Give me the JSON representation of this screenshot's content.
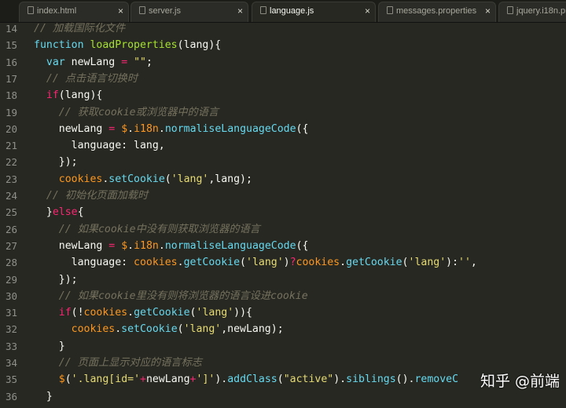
{
  "tabs": [
    {
      "label": "index.html",
      "active": false
    },
    {
      "label": "server.js",
      "active": false
    },
    {
      "label": "language.js",
      "active": true
    },
    {
      "label": "messages.properties",
      "active": false
    },
    {
      "label": "jquery.i18n.pr",
      "active": false
    }
  ],
  "close_glyph": "×",
  "lines": [
    {
      "n": "14",
      "t": [
        [
          "cm",
          "// 加载国际化文件"
        ]
      ]
    },
    {
      "n": "15",
      "t": [
        [
          "kw",
          "function "
        ],
        [
          "fn",
          "loadProperties"
        ],
        [
          "pl",
          "(lang){"
        ]
      ]
    },
    {
      "n": "16",
      "t": [
        [
          "pl",
          "  "
        ],
        [
          "kw",
          "var "
        ],
        [
          "pl",
          "newLang "
        ],
        [
          "kw2",
          "="
        ],
        [
          "pl",
          " "
        ],
        [
          "str",
          "\"\""
        ],
        [
          "pl",
          ";"
        ]
      ]
    },
    {
      "n": "17",
      "t": [
        [
          "pl",
          "  "
        ],
        [
          "cm",
          "// 点击语言切换时"
        ]
      ]
    },
    {
      "n": "18",
      "t": [
        [
          "pl",
          "  "
        ],
        [
          "kw2",
          "if"
        ],
        [
          "pl",
          "(lang){"
        ]
      ]
    },
    {
      "n": "19",
      "t": [
        [
          "pl",
          "    "
        ],
        [
          "cm",
          "// 获取cookie或浏览器中的语言"
        ]
      ]
    },
    {
      "n": "20",
      "t": [
        [
          "pl",
          "    newLang "
        ],
        [
          "kw2",
          "="
        ],
        [
          "pl",
          " "
        ],
        [
          "obj",
          "$"
        ],
        [
          "pl",
          "."
        ],
        [
          "obj",
          "i18n"
        ],
        [
          "pl",
          "."
        ],
        [
          "kw",
          "normaliseLanguageCode"
        ],
        [
          "pl",
          "({"
        ]
      ]
    },
    {
      "n": "21",
      "t": [
        [
          "pl",
          "      language: lang,"
        ]
      ]
    },
    {
      "n": "22",
      "t": [
        [
          "pl",
          "    });"
        ]
      ]
    },
    {
      "n": "23",
      "t": [
        [
          "pl",
          "    "
        ],
        [
          "obj",
          "cookies"
        ],
        [
          "pl",
          "."
        ],
        [
          "kw",
          "setCookie"
        ],
        [
          "pl",
          "("
        ],
        [
          "str",
          "'lang'"
        ],
        [
          "pl",
          ",lang);"
        ]
      ]
    },
    {
      "n": "24",
      "t": [
        [
          "pl",
          "  "
        ],
        [
          "cm",
          "// 初始化页面加载时"
        ]
      ]
    },
    {
      "n": "25",
      "t": [
        [
          "pl",
          "  }"
        ],
        [
          "kw2",
          "else"
        ],
        [
          "pl",
          "{"
        ]
      ]
    },
    {
      "n": "26",
      "t": [
        [
          "pl",
          "    "
        ],
        [
          "cm",
          "// 如果cookie中没有则获取浏览器的语言"
        ]
      ]
    },
    {
      "n": "27",
      "t": [
        [
          "pl",
          "    newLang "
        ],
        [
          "kw2",
          "="
        ],
        [
          "pl",
          " "
        ],
        [
          "obj",
          "$"
        ],
        [
          "pl",
          "."
        ],
        [
          "obj",
          "i18n"
        ],
        [
          "pl",
          "."
        ],
        [
          "kw",
          "normaliseLanguageCode"
        ],
        [
          "pl",
          "({"
        ]
      ]
    },
    {
      "n": "28",
      "t": [
        [
          "pl",
          "      language: "
        ],
        [
          "obj",
          "cookies"
        ],
        [
          "pl",
          "."
        ],
        [
          "kw",
          "getCookie"
        ],
        [
          "pl",
          "("
        ],
        [
          "str",
          "'lang'"
        ],
        [
          "pl",
          ")"
        ],
        [
          "kw2",
          "?"
        ],
        [
          "obj",
          "cookies"
        ],
        [
          "pl",
          "."
        ],
        [
          "kw",
          "getCookie"
        ],
        [
          "pl",
          "("
        ],
        [
          "str",
          "'lang'"
        ],
        [
          "pl",
          "):"
        ],
        [
          "str",
          "''"
        ],
        [
          "pl",
          ","
        ]
      ]
    },
    {
      "n": "29",
      "t": [
        [
          "pl",
          "    });"
        ]
      ]
    },
    {
      "n": "30",
      "t": [
        [
          "pl",
          "    "
        ],
        [
          "cm",
          "// 如果cookie里没有则将浏览器的语言设进cookie"
        ]
      ]
    },
    {
      "n": "31",
      "t": [
        [
          "pl",
          "    "
        ],
        [
          "kw2",
          "if"
        ],
        [
          "pl",
          "(!"
        ],
        [
          "obj",
          "cookies"
        ],
        [
          "pl",
          "."
        ],
        [
          "kw",
          "getCookie"
        ],
        [
          "pl",
          "("
        ],
        [
          "str",
          "'lang'"
        ],
        [
          "pl",
          ")){"
        ]
      ]
    },
    {
      "n": "32",
      "t": [
        [
          "pl",
          "      "
        ],
        [
          "obj",
          "cookies"
        ],
        [
          "pl",
          "."
        ],
        [
          "kw",
          "setCookie"
        ],
        [
          "pl",
          "("
        ],
        [
          "str",
          "'lang'"
        ],
        [
          "pl",
          ",newLang);"
        ]
      ]
    },
    {
      "n": "33",
      "t": [
        [
          "pl",
          "    }"
        ]
      ]
    },
    {
      "n": "34",
      "t": [
        [
          "pl",
          "    "
        ],
        [
          "cm",
          "// 页面上显示对应的语言标志"
        ]
      ]
    },
    {
      "n": "35",
      "t": [
        [
          "pl",
          "    "
        ],
        [
          "obj",
          "$"
        ],
        [
          "pl",
          "("
        ],
        [
          "str",
          "'.lang[id='"
        ],
        [
          "kw2",
          "+"
        ],
        [
          "pl",
          "newLang"
        ],
        [
          "kw2",
          "+"
        ],
        [
          "str",
          "']'"
        ],
        [
          "pl",
          ")."
        ],
        [
          "kw",
          "addClass"
        ],
        [
          "pl",
          "("
        ],
        [
          "str",
          "\"active\""
        ],
        [
          "pl",
          ")."
        ],
        [
          "kw",
          "siblings"
        ],
        [
          "pl",
          "()."
        ],
        [
          "kw",
          "removeC"
        ]
      ]
    },
    {
      "n": "36",
      "t": [
        [
          "pl",
          "  }"
        ]
      ]
    }
  ],
  "watermark": "知乎 @前端"
}
